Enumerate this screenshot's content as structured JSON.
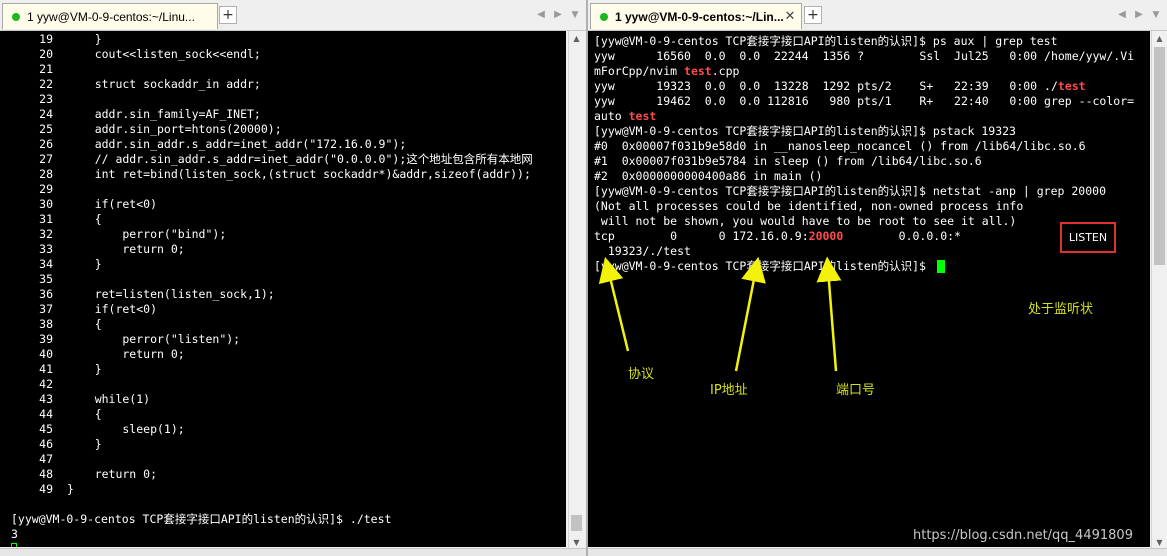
{
  "left": {
    "tab": {
      "label": "1 yyw@VM-0-9-centos:~/Linu...",
      "close": "✕"
    },
    "add_tab": "+",
    "code_lines": [
      {
        "n": "19",
        "text": "    }"
      },
      {
        "n": "20",
        "text": "    cout<<listen_sock<<endl;"
      },
      {
        "n": "21",
        "text": ""
      },
      {
        "n": "22",
        "text": "    struct sockaddr_in addr;"
      },
      {
        "n": "23",
        "text": ""
      },
      {
        "n": "24",
        "text": "    addr.sin_family=AF_INET;"
      },
      {
        "n": "25",
        "text": "    addr.sin_port=htons(20000);"
      },
      {
        "n": "26",
        "text": "    addr.sin_addr.s_addr=inet_addr(\"172.16.0.9\");"
      },
      {
        "n": "27",
        "text": "    // addr.sin_addr.s_addr=inet_addr(\"0.0.0.0\");这个地址包含所有本地网"
      },
      {
        "n": "28",
        "text": "    int ret=bind(listen_sock,(struct sockaddr*)&addr,sizeof(addr));"
      },
      {
        "n": "29",
        "text": ""
      },
      {
        "n": "30",
        "text": "    if(ret<0)"
      },
      {
        "n": "31",
        "text": "    {"
      },
      {
        "n": "32",
        "text": "        perror(\"bind\");"
      },
      {
        "n": "33",
        "text": "        return 0;"
      },
      {
        "n": "34",
        "text": "    }"
      },
      {
        "n": "35",
        "text": ""
      },
      {
        "n": "36",
        "text": "    ret=listen(listen_sock,1);"
      },
      {
        "n": "37",
        "text": "    if(ret<0)"
      },
      {
        "n": "38",
        "text": "    {"
      },
      {
        "n": "39",
        "text": "        perror(\"listen\");"
      },
      {
        "n": "40",
        "text": "        return 0;"
      },
      {
        "n": "41",
        "text": "    }"
      },
      {
        "n": "42",
        "text": ""
      },
      {
        "n": "43",
        "text": "    while(1)"
      },
      {
        "n": "44",
        "text": "    {"
      },
      {
        "n": "45",
        "text": "        sleep(1);"
      },
      {
        "n": "46",
        "text": "    }"
      },
      {
        "n": "47",
        "text": ""
      },
      {
        "n": "48",
        "text": "    return 0;"
      },
      {
        "n": "49",
        "text": "}"
      }
    ],
    "prompt_line": "[yyw@VM-0-9-centos TCP套接字接口API的listen的认识]$ ./test",
    "output_line": "3"
  },
  "right": {
    "tab": {
      "label": "1 yyw@VM-0-9-centos:~/Lin...",
      "close": "✕"
    },
    "add_tab": "+",
    "lines": [
      {
        "parts": [
          {
            "t": "[yyw@VM-0-9-centos TCP套接字接口API的listen的认识]$ ps aux | grep test"
          }
        ]
      },
      {
        "parts": [
          {
            "t": "yyw      16560  0.0  0.0  22244  1356 ?        Ssl  Jul25   0:00 /home/yyw/.Vi"
          }
        ]
      },
      {
        "parts": [
          {
            "t": "mForCpp/nvim "
          },
          {
            "t": "test",
            "hl": true
          },
          {
            "t": ".cpp"
          }
        ]
      },
      {
        "parts": [
          {
            "t": "yyw      19323  0.0  0.0  13228  1292 pts/2    S+   22:39   0:00 ./"
          },
          {
            "t": "test",
            "hl": true
          }
        ]
      },
      {
        "parts": [
          {
            "t": "yyw      19462  0.0  0.0 112816   980 pts/1    R+   22:40   0:00 grep --color="
          }
        ]
      },
      {
        "parts": [
          {
            "t": "auto "
          },
          {
            "t": "test",
            "hl": true
          }
        ]
      },
      {
        "parts": [
          {
            "t": "[yyw@VM-0-9-centos TCP套接字接口API的listen的认识]$ pstack 19323"
          }
        ]
      },
      {
        "parts": [
          {
            "t": "#0  0x00007f031b9e58d0 in __nanosleep_nocancel () from /lib64/libc.so.6"
          }
        ]
      },
      {
        "parts": [
          {
            "t": "#1  0x00007f031b9e5784 in sleep () from /lib64/libc.so.6"
          }
        ]
      },
      {
        "parts": [
          {
            "t": "#2  0x0000000000400a86 in main ()"
          }
        ]
      },
      {
        "parts": [
          {
            "t": "[yyw@VM-0-9-centos TCP套接字接口API的listen的认识]$ netstat -anp | grep 20000"
          }
        ]
      },
      {
        "parts": [
          {
            "t": "(Not all processes could be identified, non-owned process info"
          }
        ]
      },
      {
        "parts": [
          {
            "t": " will not be shown, you would have to be root to see it all.)"
          }
        ]
      },
      {
        "parts": [
          {
            "t": "tcp        0      0 172.16.0.9:"
          },
          {
            "t": "20000",
            "hl": true
          },
          {
            "t": "        0.0.0.0:*"
          }
        ]
      },
      {
        "parts": [
          {
            "t": "  19323/./test"
          }
        ]
      },
      {
        "parts": [
          {
            "t": "[yyw@VM-0-9-centos TCP套接字接口API的listen的认识]$ "
          }
        ]
      }
    ],
    "listen_state": "LISTEN",
    "annotations": {
      "protocol": "协议",
      "ip_address": "IP地址",
      "port": "端口号",
      "listening": "处于监听状"
    },
    "watermark": "https://blog.csdn.net/qq_4491809"
  },
  "colors": {
    "terminal_bg": "#000000",
    "terminal_fg": "#ffffff",
    "highlight": "#ff4b4b",
    "cursor": "#00ff00",
    "annotation": "#d4e010",
    "annotation_box": "#e03030",
    "tab_status_dot": "#1fb51f"
  }
}
